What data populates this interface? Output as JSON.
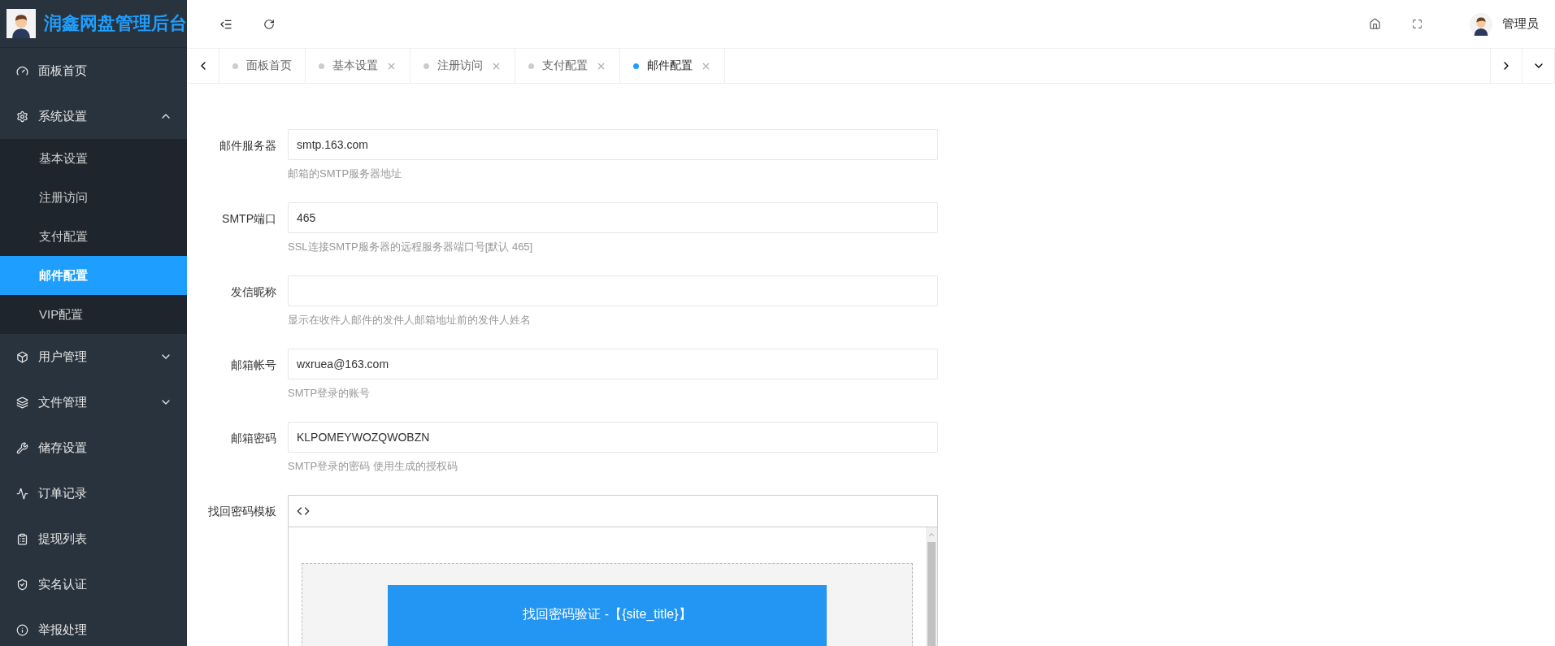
{
  "sidebar": {
    "logo_title": "润鑫网盘管理后台",
    "items": [
      {
        "label": "面板首页",
        "selected": false
      },
      {
        "label": "系统设置",
        "expanded": true,
        "selected": false,
        "children": [
          {
            "label": "基本设置",
            "selected": false
          },
          {
            "label": "注册访问",
            "selected": false
          },
          {
            "label": "支付配置",
            "selected": false
          },
          {
            "label": "邮件配置",
            "selected": true
          },
          {
            "label": "VIP配置",
            "selected": false
          }
        ]
      },
      {
        "label": "用户管理",
        "expanded": false,
        "selected": false
      },
      {
        "label": "文件管理",
        "expanded": false,
        "selected": false
      },
      {
        "label": "储存设置",
        "selected": false
      },
      {
        "label": "订单记录",
        "selected": false
      },
      {
        "label": "提现列表",
        "selected": false
      },
      {
        "label": "实名认证",
        "selected": false
      },
      {
        "label": "举报处理",
        "selected": false
      }
    ]
  },
  "header": {
    "user_name": "管理员"
  },
  "tabs": [
    {
      "label": "面板首页",
      "closable": false,
      "selected": false
    },
    {
      "label": "基本设置",
      "closable": true,
      "selected": false
    },
    {
      "label": "注册访问",
      "closable": true,
      "selected": false
    },
    {
      "label": "支付配置",
      "closable": true,
      "selected": false
    },
    {
      "label": "邮件配置",
      "closable": true,
      "selected": true
    }
  ],
  "form": {
    "fields": [
      {
        "label": "邮件服务器",
        "value": "smtp.163.com",
        "hint": "邮箱的SMTP服务器地址"
      },
      {
        "label": "SMTP端口",
        "value": "465",
        "hint": "SSL连接SMTP服务器的远程服务器端口号[默认 465]"
      },
      {
        "label": "发信昵称",
        "hint": "显示在收件人邮件的发件人邮箱地址前的发件人姓名"
      },
      {
        "label": "邮箱帐号",
        "value": "wxruea@163.com",
        "hint": "SMTP登录的账号"
      },
      {
        "label": "邮箱密码",
        "value": "KLPOMEYWOZQWOBZN",
        "hint": "SMTP登录的密码 使用生成的授权码"
      }
    ],
    "editor": {
      "label": "找回密码模板",
      "banner_title": "找回密码验证 -【{site_title}】"
    }
  }
}
